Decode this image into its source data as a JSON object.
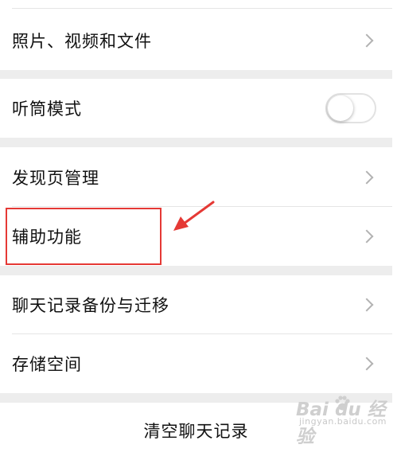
{
  "settings": {
    "media_label": "照片、视频和文件",
    "earpiece_label": "听筒模式",
    "earpiece_enabled": false,
    "discover_label": "发现页管理",
    "accessibility_label": "辅助功能",
    "backup_label": "聊天记录备份与迁移",
    "storage_label": "存储空间",
    "clear_label": "清空聊天记录"
  },
  "annotation": {
    "highlight_color": "#e53935"
  },
  "watermark": {
    "brand": "Bai du 经验",
    "url": "jingyan.baidu.com"
  },
  "colors": {
    "background": "#ededed",
    "cell": "#ffffff",
    "text": "#111111",
    "chevron": "#b2b2b2"
  }
}
